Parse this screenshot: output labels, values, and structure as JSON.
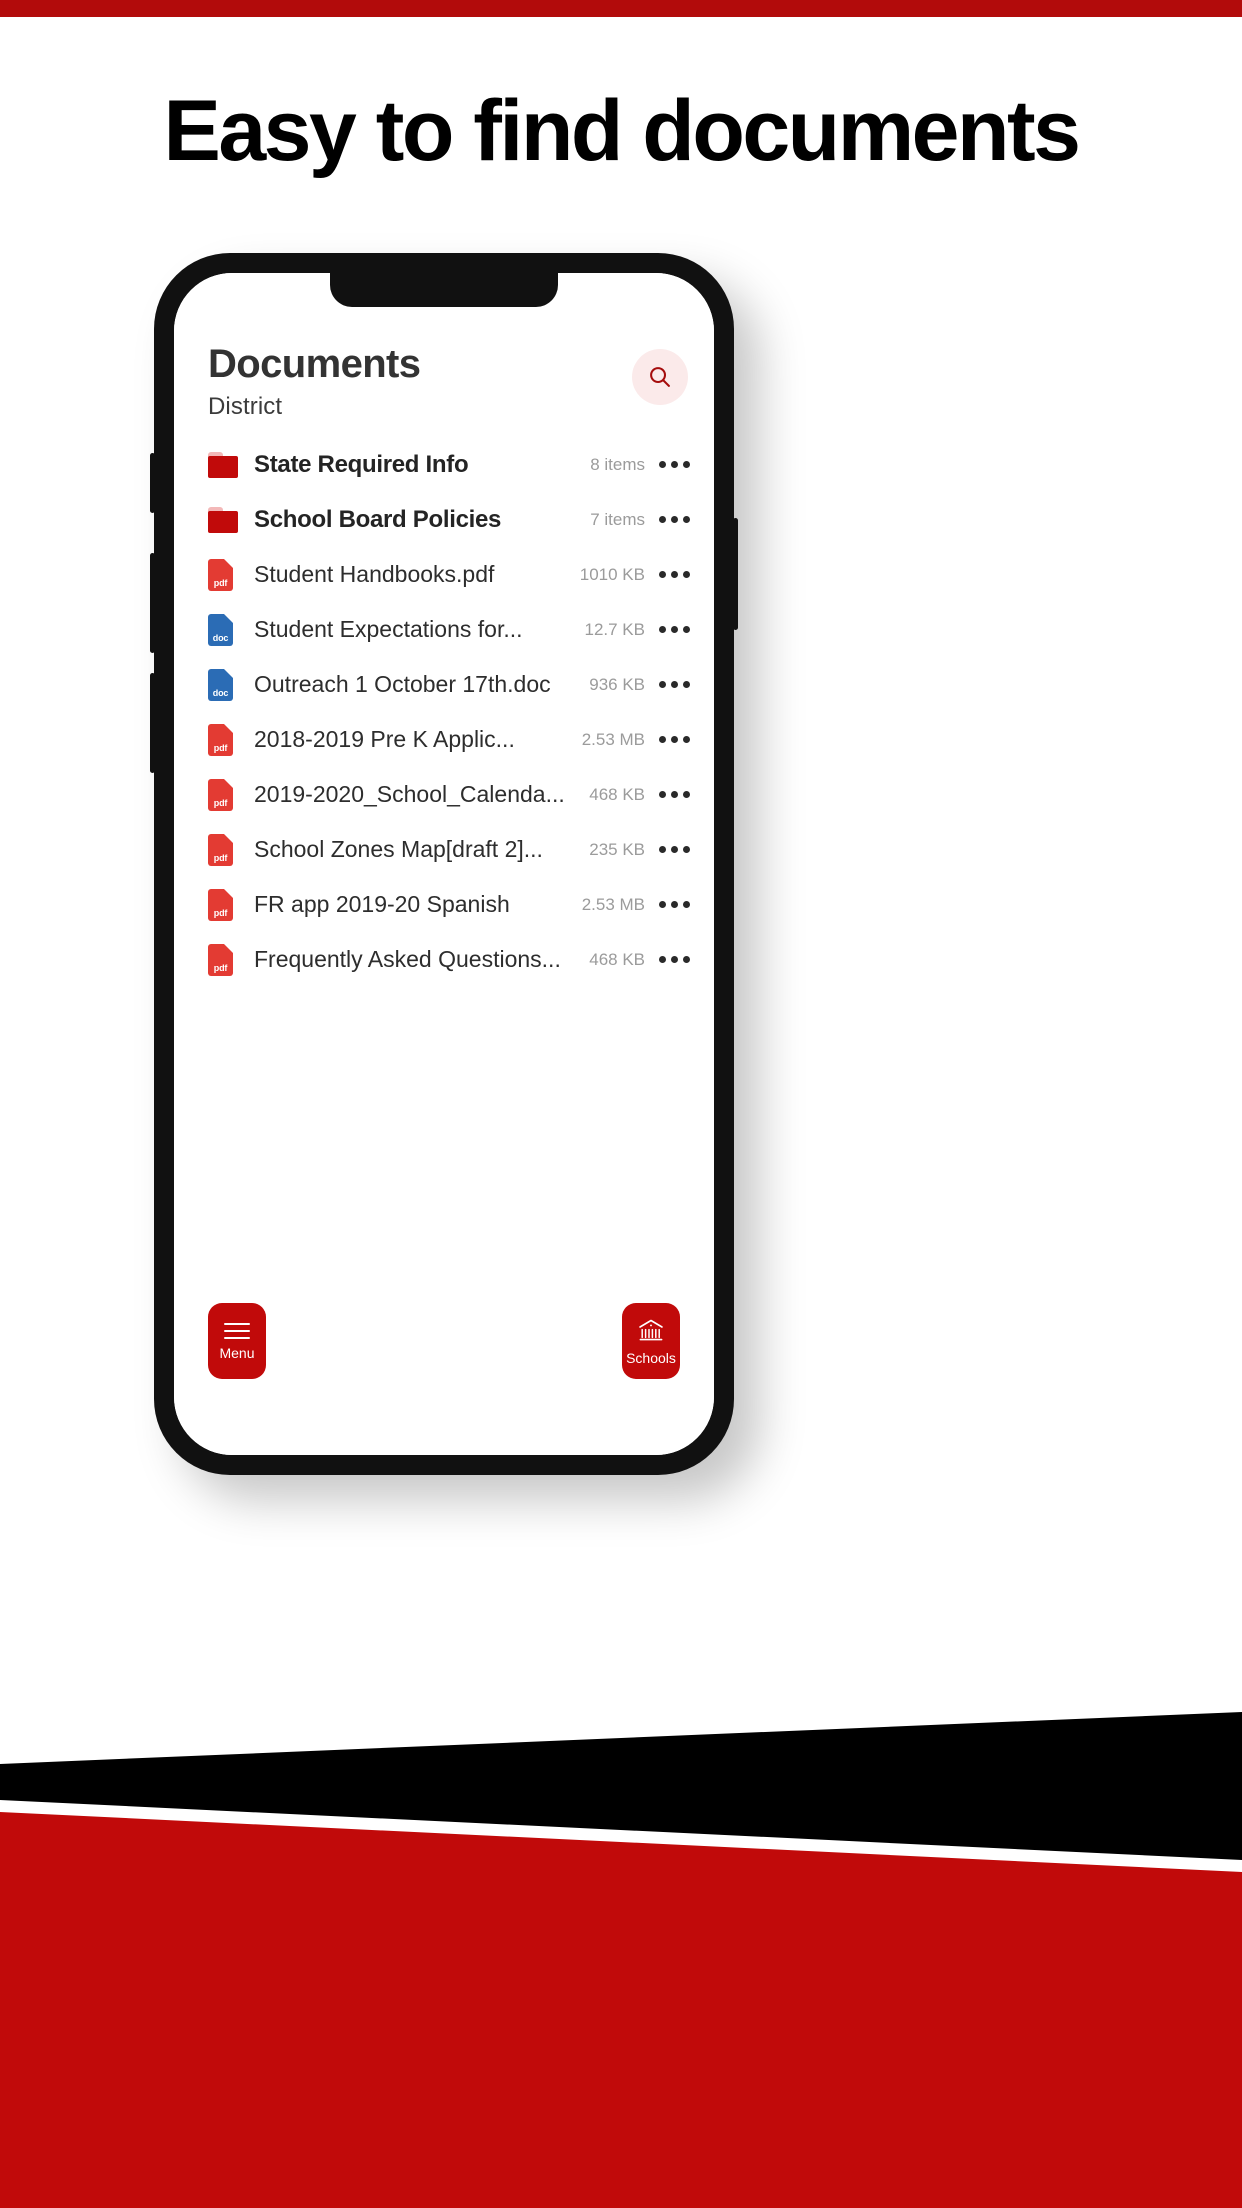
{
  "headline": "Easy to find documents",
  "theme": {
    "brand_red": "#b20b0b",
    "icon_red": "#c10a0a",
    "pdf_red": "#e33b33",
    "doc_blue": "#2b6cb5",
    "search_bg": "#fbeaea",
    "black": "#000000"
  },
  "app": {
    "title": "Documents",
    "subtitle": "District",
    "search_icon": "search-icon",
    "items": [
      {
        "type": "folder",
        "name": "State Required Info",
        "meta": "8 items",
        "icon": "folder-icon",
        "more": "more-options-icon"
      },
      {
        "type": "folder",
        "name": "School Board Policies",
        "meta": "7 items",
        "icon": "folder-icon",
        "more": "more-options-icon"
      },
      {
        "type": "pdf",
        "name": "Student Handbooks.pdf",
        "meta": "1010 KB",
        "icon": "pdf-file-icon",
        "label": "pdf",
        "more": "more-options-icon"
      },
      {
        "type": "doc",
        "name": "Student Expectations for...",
        "meta": "12.7 KB",
        "icon": "doc-file-icon",
        "label": "doc",
        "more": "more-options-icon"
      },
      {
        "type": "doc",
        "name": "Outreach 1 October 17th.doc",
        "meta": "936 KB",
        "icon": "doc-file-icon",
        "label": "doc",
        "more": "more-options-icon"
      },
      {
        "type": "pdf",
        "name": "2018-2019 Pre K Applic...",
        "meta": "2.53 MB",
        "icon": "pdf-file-icon",
        "label": "pdf",
        "more": "more-options-icon"
      },
      {
        "type": "pdf",
        "name": "2019-2020_School_Calenda...",
        "meta": "468 KB",
        "icon": "pdf-file-icon",
        "label": "pdf",
        "more": "more-options-icon"
      },
      {
        "type": "pdf",
        "name": "School Zones Map[draft 2]...",
        "meta": "235 KB",
        "icon": "pdf-file-icon",
        "label": "pdf",
        "more": "more-options-icon"
      },
      {
        "type": "pdf",
        "name": "FR app 2019-20 Spanish",
        "meta": "2.53 MB",
        "icon": "pdf-file-icon",
        "label": "pdf",
        "more": "more-options-icon"
      },
      {
        "type": "pdf",
        "name": "Frequently Asked Questions...",
        "meta": "468 KB",
        "icon": "pdf-file-icon",
        "label": "pdf",
        "more": "more-options-icon"
      }
    ],
    "bottom": {
      "menu_label": "Menu",
      "menu_icon": "hamburger-icon",
      "schools_label": "Schools",
      "schools_icon": "school-building-icon"
    }
  }
}
